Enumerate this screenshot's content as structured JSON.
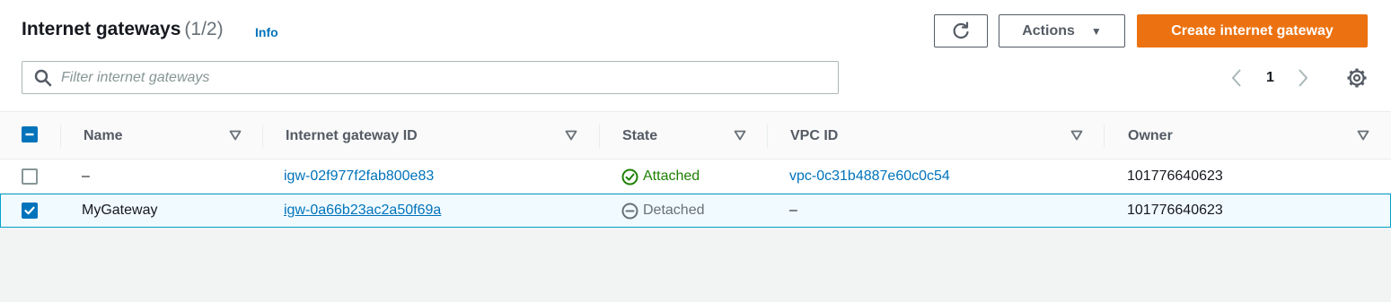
{
  "header": {
    "title": "Internet gateways",
    "count": "(1/2)",
    "info_link": "Info"
  },
  "toolbar": {
    "refresh_icon": "refresh-icon",
    "actions_label": "Actions",
    "create_label": "Create internet gateway",
    "create_color": "#ec7211"
  },
  "filter": {
    "placeholder": "Filter internet gateways",
    "value": ""
  },
  "pagination": {
    "current_page": "1"
  },
  "table": {
    "columns": [
      "Name",
      "Internet gateway ID",
      "State",
      "VPC ID",
      "Owner"
    ],
    "select_all_state": "indeterminate",
    "rows": [
      {
        "selected": false,
        "name": "–",
        "gateway_id": "igw-02f977f2fab800e83",
        "state": "Attached",
        "state_icon": "check-circle-icon",
        "vpc_id": "vpc-0c31b4887e60c0c54",
        "owner": "101776640623"
      },
      {
        "selected": true,
        "name": "MyGateway",
        "gateway_id": "igw-0a66b23ac2a50f69a",
        "state": "Detached",
        "state_icon": "minus-circle-icon",
        "vpc_id": "–",
        "owner": "101776640623"
      }
    ]
  },
  "colors": {
    "link": "#0073bb",
    "attached": "#1d8102",
    "detached": "#687078",
    "selected_border": "#00a1c9"
  }
}
